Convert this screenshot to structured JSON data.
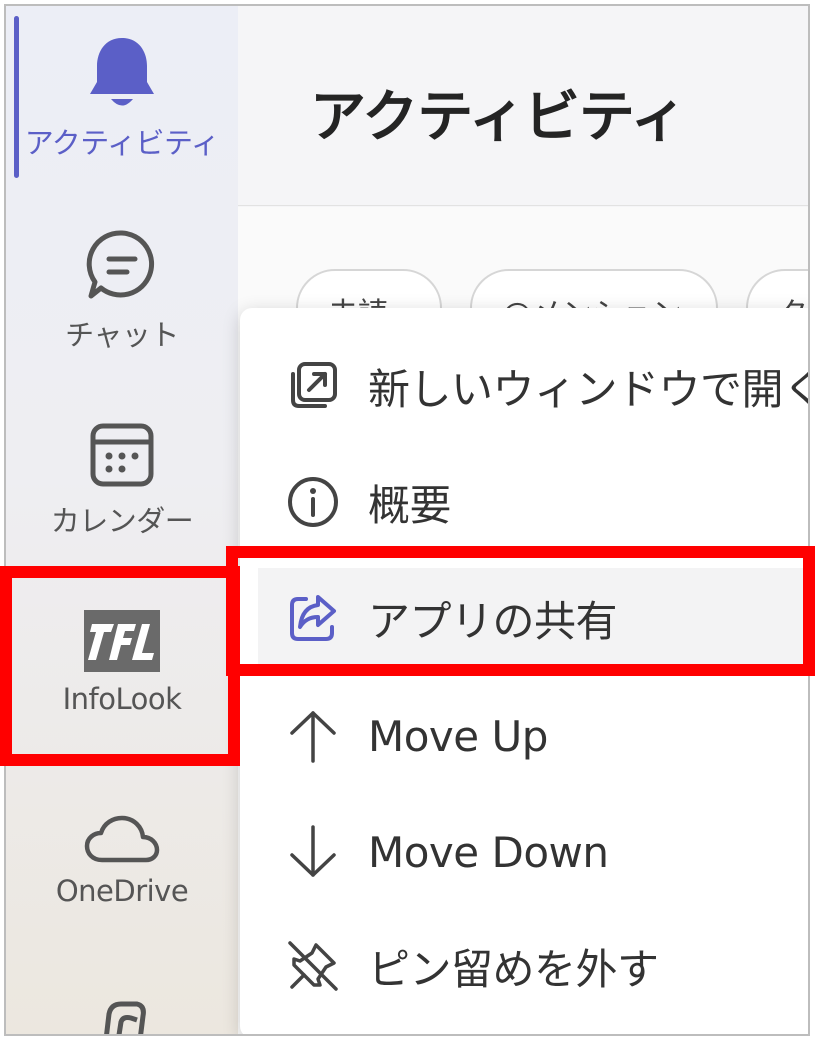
{
  "rail": {
    "items": [
      {
        "label": "アクティビティ",
        "icon": "bell-icon",
        "active": true
      },
      {
        "label": "チャット",
        "icon": "chat-icon"
      },
      {
        "label": "カレンダー",
        "icon": "calendar-icon"
      },
      {
        "label": "InfoLook",
        "icon": "infolook-logo-icon"
      },
      {
        "label": "OneDrive",
        "icon": "cloud-icon"
      },
      {
        "label": "",
        "icon": "apps-icon"
      }
    ]
  },
  "header": {
    "title": "アクティビティ"
  },
  "filters": [
    "未読",
    "@メンション",
    "タ"
  ],
  "context_menu": {
    "items": [
      {
        "label": "新しいウィンドウで開く",
        "icon": "open-window-icon"
      },
      {
        "label": "概要",
        "icon": "info-icon"
      },
      {
        "label": "アプリの共有",
        "icon": "share-icon",
        "highlighted": true
      },
      {
        "label": "Move Up",
        "icon": "arrow-up-icon"
      },
      {
        "label": "Move Down",
        "icon": "arrow-down-icon"
      },
      {
        "label": "ピン留めを外す",
        "icon": "unpin-icon"
      }
    ]
  },
  "colors": {
    "accent": "#5b5fc7",
    "annotation": "#ff0000"
  }
}
